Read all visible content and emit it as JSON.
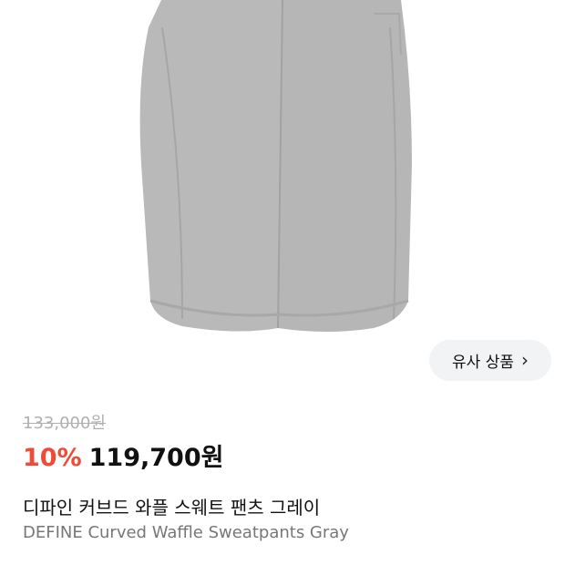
{
  "product": {
    "image_alt": "Gray sweatpants product image",
    "similar_label": "유사 상품",
    "original_price": "133,000원",
    "discount": "10%",
    "sale_price": "119,700원",
    "name_ko": "디파인 커브드 와플 스웨트 팬츠 그레이",
    "name_en": "DEFINE Curved Waffle Sweatpants Gray"
  },
  "colors": {
    "discount": "#ef4b36",
    "pants": "#b8b8b8",
    "button_bg": "#f2f3f5"
  }
}
